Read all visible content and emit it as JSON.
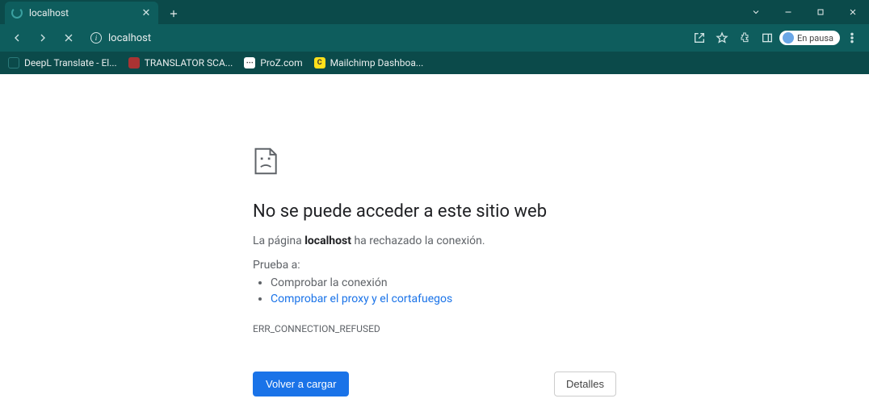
{
  "tab": {
    "title": "localhost"
  },
  "address": {
    "url": "localhost"
  },
  "bookmarks": [
    {
      "label": "DeepL Translate - El...",
      "fav": "deepl"
    },
    {
      "label": "TRANSLATOR SCA...",
      "fav": "scam"
    },
    {
      "label": "ProZ.com",
      "fav": "proz"
    },
    {
      "label": "Mailchimp Dashboa...",
      "fav": "mc"
    }
  ],
  "profile": {
    "status": "En pausa"
  },
  "error": {
    "title": "No se puede acceder a este sitio web",
    "message_prefix": "La página ",
    "message_bold": "localhost",
    "message_suffix": " ha rechazado la conexión.",
    "try_label": "Prueba a:",
    "suggestions": [
      {
        "text": "Comprobar la conexión",
        "link": false
      },
      {
        "text": "Comprobar el proxy y el cortafuegos",
        "link": true
      }
    ],
    "code": "ERR_CONNECTION_REFUSED",
    "reload_label": "Volver a cargar",
    "details_label": "Detalles"
  }
}
